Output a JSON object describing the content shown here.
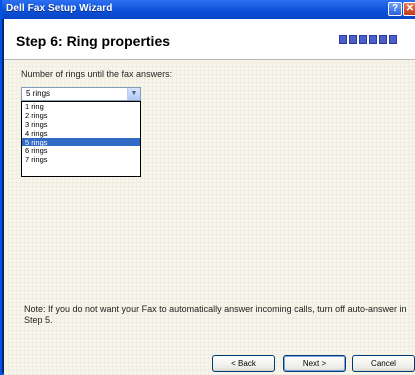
{
  "window": {
    "title": "Dell Fax Setup Wizard",
    "help_glyph": "?",
    "close_glyph": "✕"
  },
  "header": {
    "step_title": "Step 6: Ring properties",
    "progress_segments": 6
  },
  "rings": {
    "label": "Number of rings until the fax answers:",
    "selected_value": "5 rings",
    "dropdown_arrow": "▼",
    "options": [
      "1 ring",
      "2 rings",
      "3 rings",
      "4 rings",
      "5 rings",
      "6 rings",
      "7 rings"
    ],
    "highlighted_index": 4
  },
  "note": "Note: If you do not want your Fax to automatically answer incoming calls, turn off auto-answer in Step 5.",
  "buttons": {
    "back": "< Back",
    "next": "Next >",
    "cancel": "Cancel"
  },
  "colors": {
    "selection": "#316ac5",
    "progress": "#4a5fc8"
  }
}
